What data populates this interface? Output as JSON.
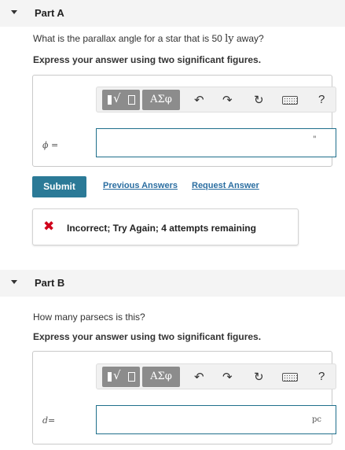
{
  "part_a": {
    "title": "Part A",
    "question_prefix": "What is the parallax angle for a star that is 50 ",
    "question_unit": "ly",
    "question_suffix": " away?",
    "instruction": "Express your answer using two significant figures.",
    "toolbar": {
      "greek_label": "ΑΣφ",
      "help_label": "?"
    },
    "variable": "ϕ",
    "equals": "=",
    "input_value": "",
    "unit": "\"",
    "submit_label": "Submit",
    "previous_answers_label": "Previous Answers",
    "request_answer_label": "Request Answer",
    "feedback": "Incorrect; Try Again; 4 attempts remaining",
    "feedback_color": "#d0021b"
  },
  "part_b": {
    "title": "Part B",
    "question": "How many parsecs is this?",
    "instruction": "Express your answer using two significant figures.",
    "toolbar": {
      "greek_label": "ΑΣφ",
      "help_label": "?"
    },
    "variable": "d",
    "equals": "=",
    "input_value": "",
    "unit": "pc"
  },
  "colors": {
    "accent": "#2b7a97",
    "link": "#2b6ea1",
    "toolbar_button": "#8c8c8c",
    "header_bg": "#f4f4f4"
  }
}
